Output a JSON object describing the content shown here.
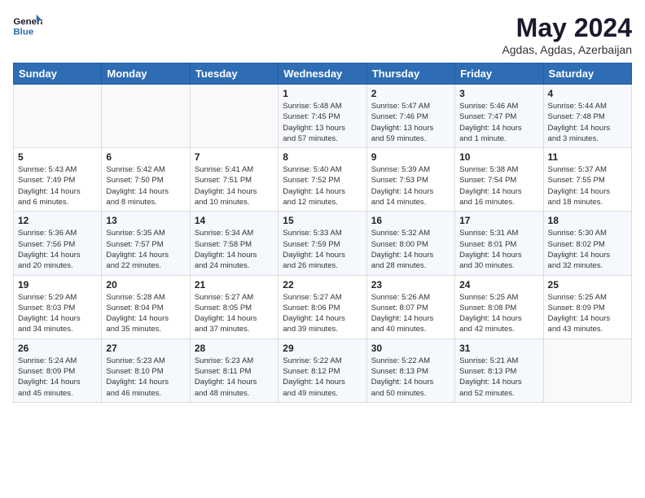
{
  "logo": {
    "line1": "General",
    "line2": "Blue"
  },
  "title": "May 2024",
  "subtitle": "Agdas, Agdas, Azerbaijan",
  "weekdays": [
    "Sunday",
    "Monday",
    "Tuesday",
    "Wednesday",
    "Thursday",
    "Friday",
    "Saturday"
  ],
  "weeks": [
    [
      {
        "day": "",
        "info": ""
      },
      {
        "day": "",
        "info": ""
      },
      {
        "day": "",
        "info": ""
      },
      {
        "day": "1",
        "info": "Sunrise: 5:48 AM\nSunset: 7:45 PM\nDaylight: 13 hours\nand 57 minutes."
      },
      {
        "day": "2",
        "info": "Sunrise: 5:47 AM\nSunset: 7:46 PM\nDaylight: 13 hours\nand 59 minutes."
      },
      {
        "day": "3",
        "info": "Sunrise: 5:46 AM\nSunset: 7:47 PM\nDaylight: 14 hours\nand 1 minute."
      },
      {
        "day": "4",
        "info": "Sunrise: 5:44 AM\nSunset: 7:48 PM\nDaylight: 14 hours\nand 3 minutes."
      }
    ],
    [
      {
        "day": "5",
        "info": "Sunrise: 5:43 AM\nSunset: 7:49 PM\nDaylight: 14 hours\nand 6 minutes."
      },
      {
        "day": "6",
        "info": "Sunrise: 5:42 AM\nSunset: 7:50 PM\nDaylight: 14 hours\nand 8 minutes."
      },
      {
        "day": "7",
        "info": "Sunrise: 5:41 AM\nSunset: 7:51 PM\nDaylight: 14 hours\nand 10 minutes."
      },
      {
        "day": "8",
        "info": "Sunrise: 5:40 AM\nSunset: 7:52 PM\nDaylight: 14 hours\nand 12 minutes."
      },
      {
        "day": "9",
        "info": "Sunrise: 5:39 AM\nSunset: 7:53 PM\nDaylight: 14 hours\nand 14 minutes."
      },
      {
        "day": "10",
        "info": "Sunrise: 5:38 AM\nSunset: 7:54 PM\nDaylight: 14 hours\nand 16 minutes."
      },
      {
        "day": "11",
        "info": "Sunrise: 5:37 AM\nSunset: 7:55 PM\nDaylight: 14 hours\nand 18 minutes."
      }
    ],
    [
      {
        "day": "12",
        "info": "Sunrise: 5:36 AM\nSunset: 7:56 PM\nDaylight: 14 hours\nand 20 minutes."
      },
      {
        "day": "13",
        "info": "Sunrise: 5:35 AM\nSunset: 7:57 PM\nDaylight: 14 hours\nand 22 minutes."
      },
      {
        "day": "14",
        "info": "Sunrise: 5:34 AM\nSunset: 7:58 PM\nDaylight: 14 hours\nand 24 minutes."
      },
      {
        "day": "15",
        "info": "Sunrise: 5:33 AM\nSunset: 7:59 PM\nDaylight: 14 hours\nand 26 minutes."
      },
      {
        "day": "16",
        "info": "Sunrise: 5:32 AM\nSunset: 8:00 PM\nDaylight: 14 hours\nand 28 minutes."
      },
      {
        "day": "17",
        "info": "Sunrise: 5:31 AM\nSunset: 8:01 PM\nDaylight: 14 hours\nand 30 minutes."
      },
      {
        "day": "18",
        "info": "Sunrise: 5:30 AM\nSunset: 8:02 PM\nDaylight: 14 hours\nand 32 minutes."
      }
    ],
    [
      {
        "day": "19",
        "info": "Sunrise: 5:29 AM\nSunset: 8:03 PM\nDaylight: 14 hours\nand 34 minutes."
      },
      {
        "day": "20",
        "info": "Sunrise: 5:28 AM\nSunset: 8:04 PM\nDaylight: 14 hours\nand 35 minutes."
      },
      {
        "day": "21",
        "info": "Sunrise: 5:27 AM\nSunset: 8:05 PM\nDaylight: 14 hours\nand 37 minutes."
      },
      {
        "day": "22",
        "info": "Sunrise: 5:27 AM\nSunset: 8:06 PM\nDaylight: 14 hours\nand 39 minutes."
      },
      {
        "day": "23",
        "info": "Sunrise: 5:26 AM\nSunset: 8:07 PM\nDaylight: 14 hours\nand 40 minutes."
      },
      {
        "day": "24",
        "info": "Sunrise: 5:25 AM\nSunset: 8:08 PM\nDaylight: 14 hours\nand 42 minutes."
      },
      {
        "day": "25",
        "info": "Sunrise: 5:25 AM\nSunset: 8:09 PM\nDaylight: 14 hours\nand 43 minutes."
      }
    ],
    [
      {
        "day": "26",
        "info": "Sunrise: 5:24 AM\nSunset: 8:09 PM\nDaylight: 14 hours\nand 45 minutes."
      },
      {
        "day": "27",
        "info": "Sunrise: 5:23 AM\nSunset: 8:10 PM\nDaylight: 14 hours\nand 46 minutes."
      },
      {
        "day": "28",
        "info": "Sunrise: 5:23 AM\nSunset: 8:11 PM\nDaylight: 14 hours\nand 48 minutes."
      },
      {
        "day": "29",
        "info": "Sunrise: 5:22 AM\nSunset: 8:12 PM\nDaylight: 14 hours\nand 49 minutes."
      },
      {
        "day": "30",
        "info": "Sunrise: 5:22 AM\nSunset: 8:13 PM\nDaylight: 14 hours\nand 50 minutes."
      },
      {
        "day": "31",
        "info": "Sunrise: 5:21 AM\nSunset: 8:13 PM\nDaylight: 14 hours\nand 52 minutes."
      },
      {
        "day": "",
        "info": ""
      }
    ]
  ]
}
